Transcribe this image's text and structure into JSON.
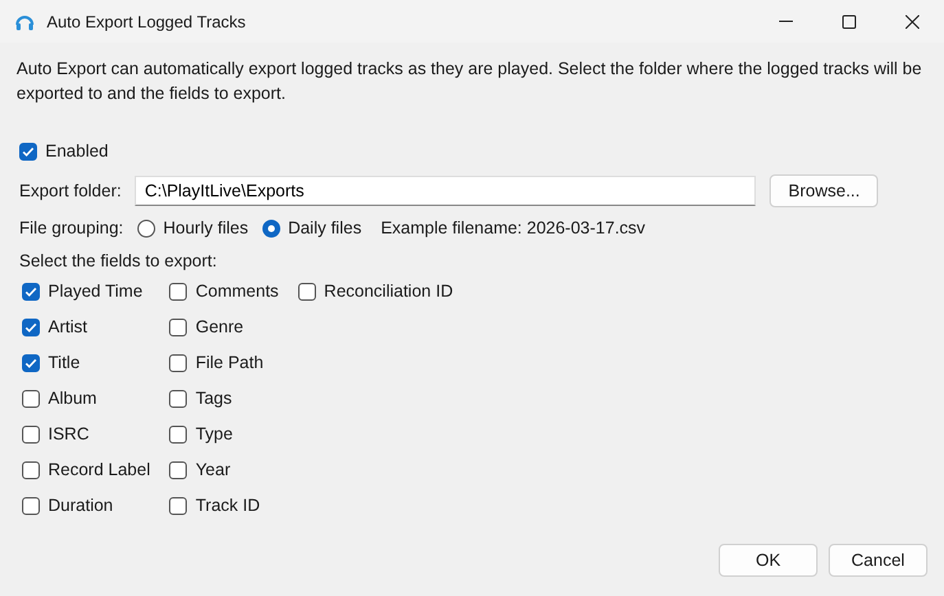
{
  "window": {
    "title": "Auto Export Logged Tracks"
  },
  "description": "Auto Export can automatically export logged tracks as they are played. Select the folder where the logged tracks will be exported to and the fields to export.",
  "enabled": {
    "label": "Enabled",
    "checked": true
  },
  "export_folder": {
    "label": "Export folder:",
    "value": "C:\\PlayItLive\\Exports",
    "browse": "Browse..."
  },
  "file_grouping": {
    "label": "File grouping:",
    "options": [
      {
        "label": "Hourly files",
        "selected": false
      },
      {
        "label": "Daily files",
        "selected": true
      }
    ],
    "example": "Example filename: 2026-03-17.csv"
  },
  "fields_label": "Select the fields to export:",
  "field_columns": [
    [
      {
        "label": "Played Time",
        "checked": true
      },
      {
        "label": "Artist",
        "checked": true
      },
      {
        "label": "Title",
        "checked": true
      },
      {
        "label": "Album",
        "checked": false
      },
      {
        "label": "ISRC",
        "checked": false
      },
      {
        "label": "Record Label",
        "checked": false
      },
      {
        "label": "Duration",
        "checked": false
      }
    ],
    [
      {
        "label": "Comments",
        "checked": false
      },
      {
        "label": "Genre",
        "checked": false
      },
      {
        "label": "File Path",
        "checked": false
      },
      {
        "label": "Tags",
        "checked": false
      },
      {
        "label": "Type",
        "checked": false
      },
      {
        "label": "Year",
        "checked": false
      },
      {
        "label": "Track ID",
        "checked": false
      }
    ],
    [
      {
        "label": "Reconciliation ID",
        "checked": false
      }
    ]
  ],
  "buttons": [
    "OK",
    "Cancel"
  ]
}
